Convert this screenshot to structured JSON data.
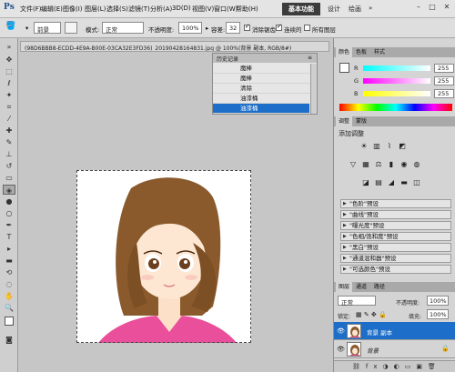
{
  "app": {
    "logo": "Ps"
  },
  "menu": [
    "文件(F)",
    "编辑(E)",
    "图像(I)",
    "图层(L)",
    "选择(S)",
    "滤镜(T)",
    "分析(A)",
    "3D(D)",
    "视图(V)",
    "窗口(W)",
    "帮助(H)"
  ],
  "menubar": {
    "zoom": "100%",
    "workspace_active": "基本功能",
    "workspace_design": "设计",
    "workspace_paint": "绘画"
  },
  "options": {
    "preset_label": "前景",
    "mode_label": "模式:",
    "mode_value": "正常",
    "opacity_label": "不透明度:",
    "opacity_value": "100%",
    "tolerance_label": "容差:",
    "tolerance_value": "32",
    "antialias_label": "消除锯齿",
    "contiguous_label": "连续的",
    "all_layers_label": "所有图层"
  },
  "document": {
    "tab_title": "(98D6BBB8-ECDD-4E9A-B00E-03CA32E3FD36)_20190428164831.jpg @ 100%(背景 副本, RGB/8#)"
  },
  "history": {
    "tab": "历史记录",
    "rows": [
      "魔棒",
      "魔棒",
      "清除",
      "油漆桶",
      "油漆桶"
    ]
  },
  "color_panel": {
    "tabs": [
      "颜色",
      "色板",
      "样式"
    ],
    "channels": [
      {
        "letter": "R",
        "value": "255"
      },
      {
        "letter": "G",
        "value": "255"
      },
      {
        "letter": "B",
        "value": "255"
      }
    ]
  },
  "adjust_panel": {
    "tabs": [
      "调整",
      "蒙版"
    ],
    "title": "添加调整",
    "presets": [
      "\"色阶\"预设",
      "\"曲线\"预设",
      "\"曝光度\"预设",
      "\"色相/饱和度\"预设",
      "\"黑白\"预设",
      "\"通道混和器\"预设",
      "\"可选颜色\"预设"
    ]
  },
  "layers_panel": {
    "tabs": [
      "图层",
      "通道",
      "路径"
    ],
    "blend_mode": "正常",
    "opacity_label": "不透明度:",
    "opacity_value": "100%",
    "lock_label": "锁定:",
    "fill_label": "填充:",
    "fill_value": "100%",
    "layers": [
      {
        "name": "背景 副本",
        "selected": true
      },
      {
        "name": "背景",
        "selected": false
      }
    ]
  },
  "colors": {
    "accent": "#1d6ec8",
    "hair": "#8a5a2c",
    "shirt": "#e94f9a"
  }
}
